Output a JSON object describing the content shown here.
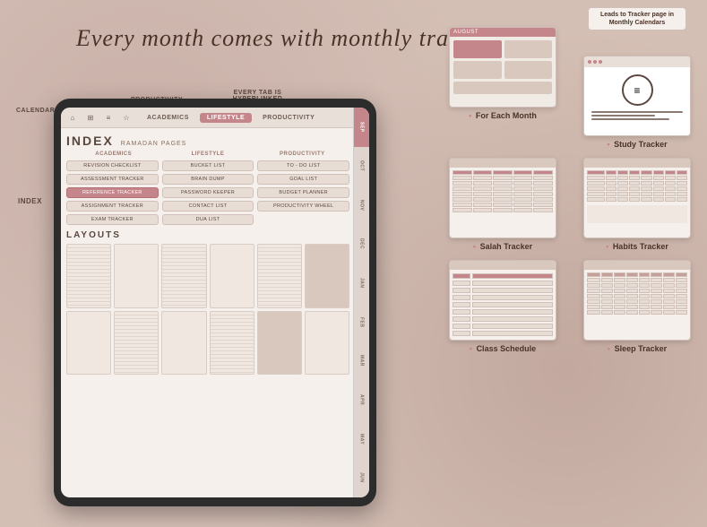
{
  "heading": "Every month comes with monthly trackers",
  "annotations": {
    "calendar_page": "CALENDAR PAGE",
    "productivity_wheel": "PRODUCTIVITY WHEEL",
    "every_tab": "EVERY TAB IS HYPERLINKED",
    "index": "INDEX"
  },
  "tablet": {
    "tabs": [
      "ACADEMICS",
      "LIFESTYLE",
      "PRODUCTIVITY"
    ],
    "active_tab": "LIFESTYLE",
    "index_label": "INDEX",
    "ramadan_label": "RAMADAN PAGES",
    "col_headers": [
      "ACADEMICS",
      "LIFESTYLE",
      "PRODUCTIVITY"
    ],
    "academics_items": [
      "REVISION CHECKLIST",
      "ASSESSMENT TRACKER",
      "REFERENCE TRACKER",
      "ASSIGNMENT TRACKER",
      "EXAM TRACKER"
    ],
    "lifestyle_items": [
      "BUCKET LIST",
      "BRAIN DUMP",
      "PASSWORD KEEPER",
      "CONTACT LIST",
      "DUA LIST"
    ],
    "productivity_items": [
      "TO - DO LIST",
      "GOAL LIST",
      "BUDGET PLANNER",
      "PRODUCTIVITY WHEEL"
    ],
    "layouts_label": "LAYOUTS",
    "months": [
      "SEP",
      "OCT",
      "NOV",
      "DEC",
      "JAN",
      "FEB",
      "MAR",
      "APR",
      "MAY",
      "JUN"
    ]
  },
  "right_panel": {
    "arrow_text": "Leads to Tracker page in Monthly Calendars",
    "items": [
      {
        "label": "For Each Month",
        "type": "august"
      },
      {
        "label": "Study Tracker",
        "type": "browser"
      },
      {
        "label": "Salah Tracker",
        "type": "salah"
      },
      {
        "label": "Habits Tracker",
        "type": "habits"
      },
      {
        "label": "Class Schedule",
        "type": "schedule"
      },
      {
        "label": "Sleep Tracker",
        "type": "sleep"
      }
    ]
  }
}
